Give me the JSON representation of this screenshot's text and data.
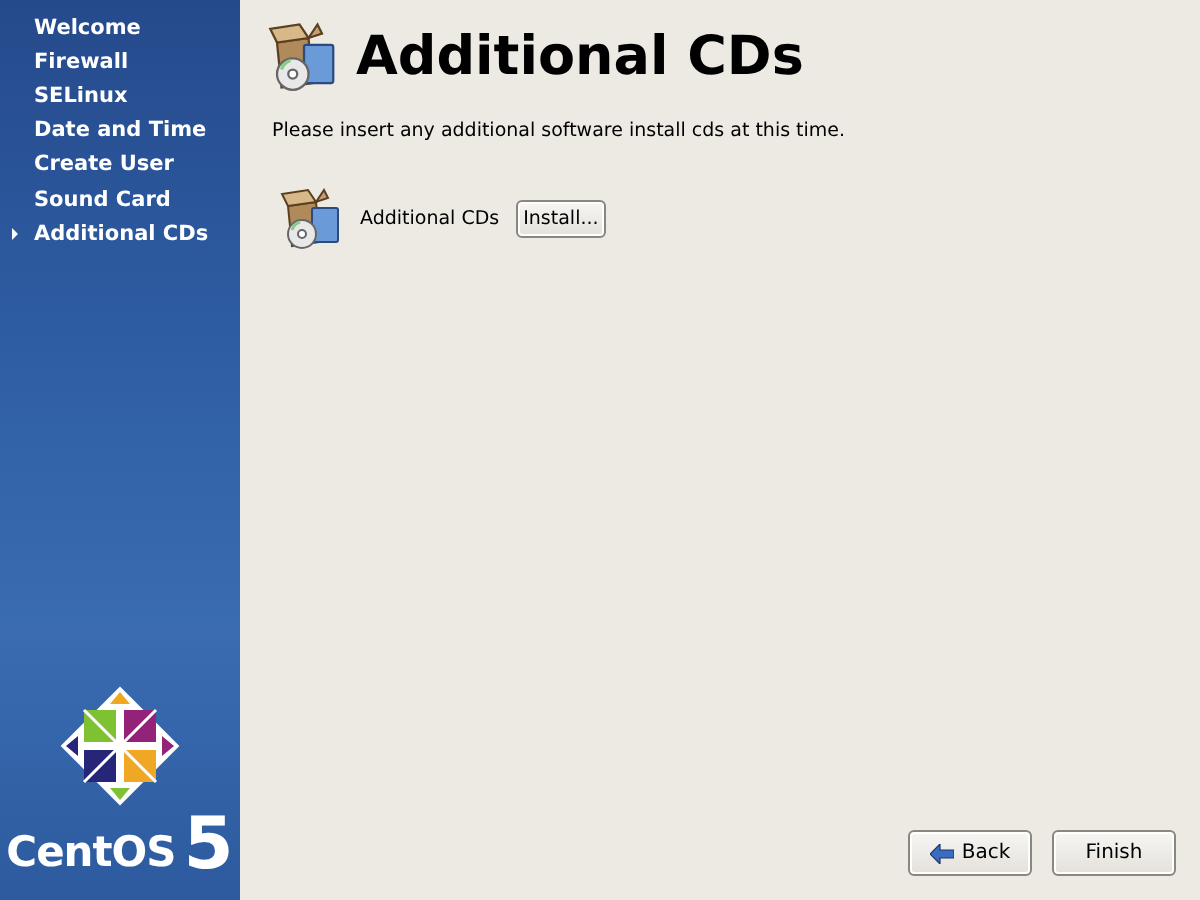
{
  "sidebar": {
    "steps": [
      {
        "label": "Welcome",
        "selected": false
      },
      {
        "label": "Firewall",
        "selected": false
      },
      {
        "label": "SELinux",
        "selected": false
      },
      {
        "label": "Date and Time",
        "selected": false
      },
      {
        "label": "Create User",
        "selected": false
      },
      {
        "label": "Sound Card",
        "selected": false
      },
      {
        "label": "Additional CDs",
        "selected": true
      }
    ],
    "logo": {
      "name": "CentOS",
      "version": "5"
    }
  },
  "page": {
    "title": "Additional CDs",
    "description": "Please insert any additional software install cds at this time.",
    "item": {
      "label": "Additional CDs",
      "button": "Install..."
    }
  },
  "buttons": [
    {
      "kind": "back",
      "label": "Back"
    },
    {
      "kind": "finish",
      "label": "Finish"
    }
  ]
}
